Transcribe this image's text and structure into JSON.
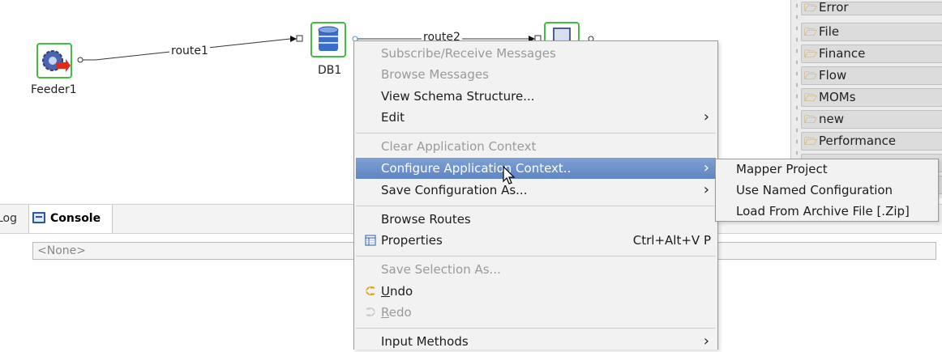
{
  "diagram": {
    "nodes": [
      {
        "label": "Feeder1",
        "icon": "gear-feeder-icon"
      },
      {
        "label": "DB1",
        "icon": "database-icon"
      },
      {
        "label": "",
        "icon": "document-icon"
      }
    ],
    "routes": [
      "route1",
      "route2"
    ]
  },
  "palette": {
    "items": [
      "Error",
      "File",
      "Finance",
      "Flow",
      "MOMs",
      "new",
      "Performance"
    ]
  },
  "console": {
    "log_tab": "Log",
    "console_tab": "Console",
    "field_value": "<None>"
  },
  "context_menu": {
    "items": [
      {
        "label": "Subscribe/Receive Messages",
        "disabled": true
      },
      {
        "label": "Browse Messages",
        "disabled": true
      },
      {
        "label": "View Schema Structure...",
        "disabled": false
      },
      {
        "label": "Edit",
        "submenu": true
      },
      {
        "label": "Clear Application Context",
        "disabled": true
      },
      {
        "label": "Configure Application Context..",
        "submenu": true,
        "highlighted": true
      },
      {
        "label": "Save Configuration As...",
        "submenu": true
      },
      {
        "label": "Browse Routes"
      },
      {
        "label": "Properties",
        "accelerator": "Ctrl+Alt+V P",
        "icon": "properties-icon"
      },
      {
        "label": "Save Selection As...",
        "disabled": true
      },
      {
        "label_mnemonic": "U",
        "label_rest": "ndo",
        "icon": "undo-icon"
      },
      {
        "label_mnemonic": "R",
        "label_rest": "edo",
        "disabled": true,
        "icon": "redo-icon"
      },
      {
        "label": "Input Methods",
        "submenu": true
      }
    ],
    "submenu_arrow": "›"
  },
  "submenu": {
    "items": [
      "Mapper Project",
      "Use Named Configuration",
      "Load From Archive File [.Zip]"
    ]
  },
  "colors": {
    "highlight": "#6b90c9",
    "node_border": "#3fbf3f",
    "disabled_text": "#9a9a9a"
  }
}
